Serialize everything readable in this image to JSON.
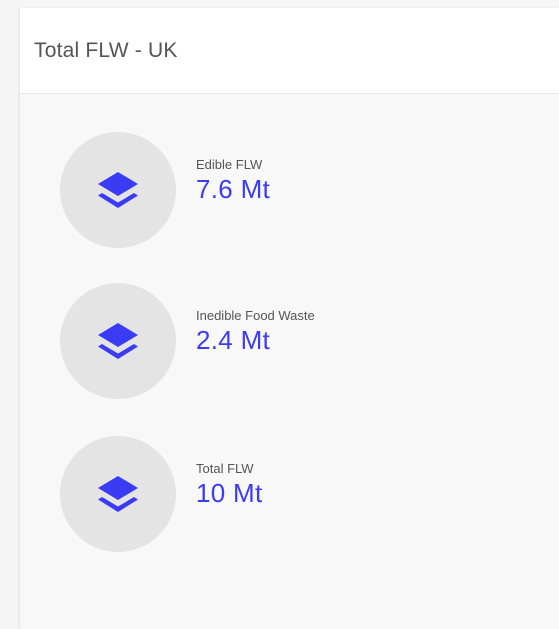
{
  "card": {
    "title": "Total FLW - UK"
  },
  "colors": {
    "accent": "#3b3bf5",
    "icon_bg": "#e4e4e4"
  },
  "stats": [
    {
      "label": "Edible FLW",
      "value": "7.6 Mt",
      "icon": "layers-icon"
    },
    {
      "label": "Inedible Food Waste",
      "value": "2.4 Mt",
      "icon": "layers-icon"
    },
    {
      "label": "Total FLW",
      "value": "10 Mt",
      "icon": "layers-icon"
    }
  ]
}
